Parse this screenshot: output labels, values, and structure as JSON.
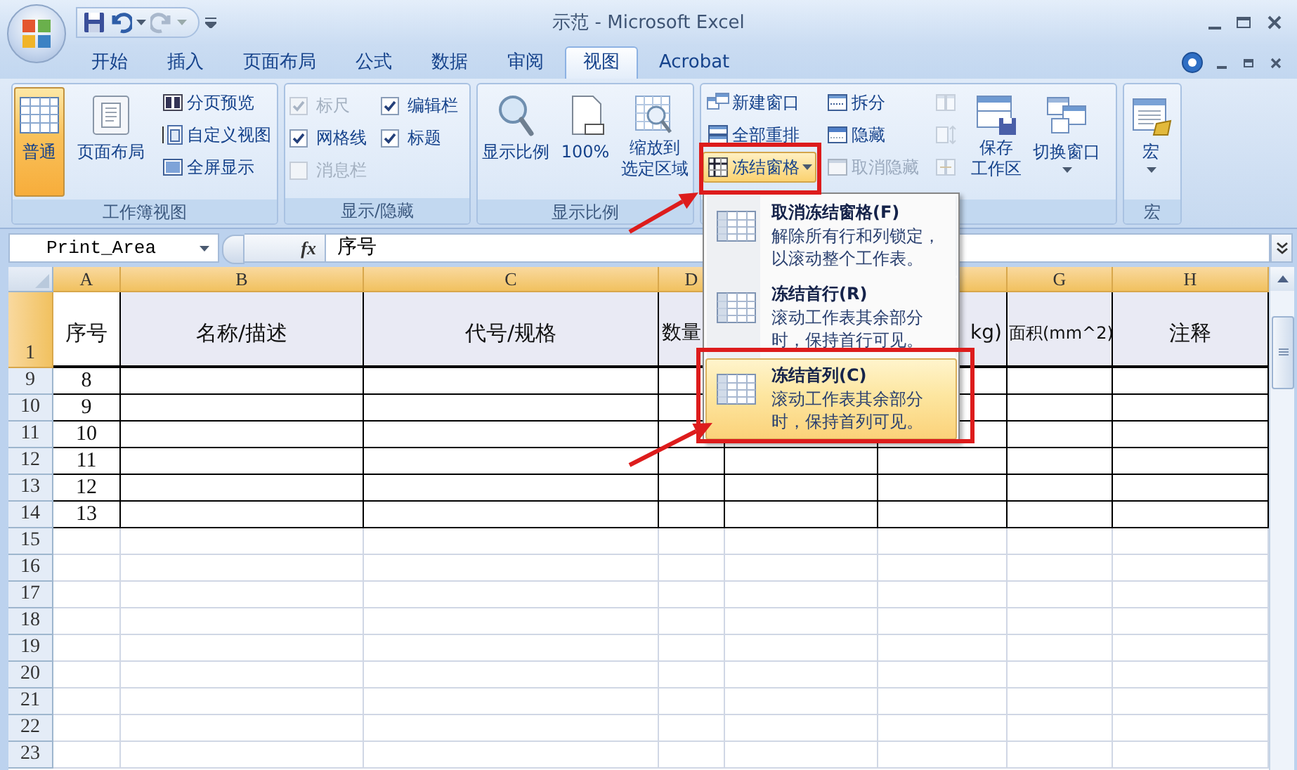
{
  "window": {
    "title": "示范 - Microsoft Excel"
  },
  "ribbon_tabs": [
    {
      "label": "开始",
      "selected": false
    },
    {
      "label": "插入",
      "selected": false
    },
    {
      "label": "页面布局",
      "selected": false
    },
    {
      "label": "公式",
      "selected": false
    },
    {
      "label": "数据",
      "selected": false
    },
    {
      "label": "审阅",
      "selected": false
    },
    {
      "label": "视图",
      "selected": true
    },
    {
      "label": "Acrobat",
      "selected": false
    }
  ],
  "ribbon_groups": [
    {
      "label": "工作簿视图",
      "items": [
        {
          "kind": "large",
          "label": "普通",
          "selected": true
        },
        {
          "kind": "large",
          "label": "页面布局",
          "selected": false
        },
        {
          "kind": "small",
          "label": "分页预览",
          "disabled": false
        },
        {
          "kind": "small",
          "label": "自定义视图",
          "disabled": false
        },
        {
          "kind": "small",
          "label": "全屏显示",
          "disabled": false
        }
      ]
    },
    {
      "label": "显示/隐藏",
      "items": [
        {
          "kind": "checkbox",
          "label": "标尺",
          "checked": true,
          "disabled": true
        },
        {
          "kind": "checkbox",
          "label": "编辑栏",
          "checked": true,
          "disabled": false
        },
        {
          "kind": "checkbox",
          "label": "网格线",
          "checked": true,
          "disabled": false
        },
        {
          "kind": "checkbox",
          "label": "标题",
          "checked": true,
          "disabled": false
        },
        {
          "kind": "checkbox",
          "label": "消息栏",
          "checked": false,
          "disabled": true
        }
      ]
    },
    {
      "label": "显示比例",
      "items": [
        {
          "kind": "large",
          "label": "显示比例",
          "selected": false
        },
        {
          "kind": "large",
          "label": "100%",
          "selected": false
        },
        {
          "kind": "large",
          "lines": [
            "缩放到",
            "选定区域"
          ],
          "selected": false
        }
      ]
    },
    {
      "items": [
        {
          "kind": "small",
          "label": "新建窗口",
          "disabled": false
        },
        {
          "kind": "small",
          "label": "全部重排",
          "disabled": false
        },
        {
          "kind": "dropdown",
          "label": "冻结窗格",
          "expanded": true
        },
        {
          "kind": "small",
          "label": "拆分",
          "disabled": false
        },
        {
          "kind": "small",
          "label": "隐藏",
          "disabled": false
        },
        {
          "kind": "small",
          "label": "取消隐藏",
          "disabled": true
        },
        {
          "kind": "icon",
          "disabled": true
        },
        {
          "kind": "icon",
          "disabled": true
        },
        {
          "kind": "icon",
          "disabled": true
        },
        {
          "kind": "large",
          "lines": [
            "保存",
            "工作区"
          ],
          "selected": false
        },
        {
          "kind": "large-dropdown",
          "label": "切换窗口",
          "selected": false
        }
      ]
    },
    {
      "label": "宏",
      "items": [
        {
          "kind": "large-dropdown",
          "label": "宏",
          "selected": false
        }
      ]
    }
  ],
  "formula_bar": {
    "name_box": "Print_Area",
    "fx_label": "fx",
    "formula": "序号"
  },
  "sheet": {
    "columns": [
      {
        "letter": "A",
        "heading": "序号",
        "selected": true
      },
      {
        "letter": "B",
        "heading": "名称/描述",
        "selected": true
      },
      {
        "letter": "C",
        "heading": "代号/规格",
        "selected": true
      },
      {
        "letter": "D",
        "heading": "数量",
        "selected": true
      },
      {
        "heading": "kg)",
        "selected": true
      },
      {
        "letter": "G",
        "heading": "面积(mm^2)",
        "selected": true
      },
      {
        "letter": "H",
        "heading": "注释",
        "selected": true
      }
    ],
    "header_row": {
      "number": "1",
      "selected": true
    },
    "rows": [
      {
        "number": "9",
        "kind": "filled",
        "cells": [
          "8"
        ]
      },
      {
        "number": "10",
        "kind": "filled",
        "cells": [
          "9"
        ]
      },
      {
        "number": "11",
        "kind": "filled",
        "cells": [
          "10"
        ]
      },
      {
        "number": "12",
        "kind": "filled",
        "cells": [
          "11"
        ]
      },
      {
        "number": "13",
        "kind": "filled",
        "cells": [
          "12"
        ]
      },
      {
        "number": "14",
        "kind": "filled",
        "cells": [
          "13"
        ]
      },
      {
        "number": "15",
        "kind": "blank"
      },
      {
        "number": "16",
        "kind": "blank"
      },
      {
        "number": "17",
        "kind": "blank"
      },
      {
        "number": "18",
        "kind": "blank"
      },
      {
        "number": "19",
        "kind": "blank"
      },
      {
        "number": "20",
        "kind": "blank"
      },
      {
        "number": "21",
        "kind": "blank"
      },
      {
        "number": "22",
        "kind": "blank"
      },
      {
        "number": "23",
        "kind": "blank"
      }
    ]
  },
  "freeze_menu": {
    "items": [
      {
        "title": "取消冻结窗格(F)",
        "description_lines": [
          "解除所有行和列锁定，",
          "以滚动整个工作表。"
        ],
        "selected": false
      },
      {
        "title": "冻结首行(R)",
        "description_lines": [
          "滚动工作表其余部分",
          "时，保持首行可见。"
        ],
        "selected": false
      },
      {
        "title": "冻结首列(C)",
        "description_lines": [
          "滚动工作表其余部分",
          "时，保持首列可见。"
        ],
        "selected": true
      }
    ]
  },
  "annotations": [
    {
      "kind": "box"
    },
    {
      "kind": "arrow"
    },
    {
      "kind": "box"
    },
    {
      "kind": "arrow"
    }
  ]
}
